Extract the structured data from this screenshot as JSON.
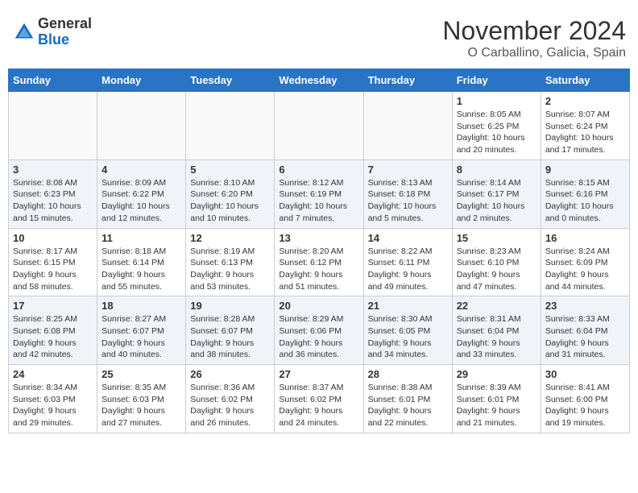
{
  "header": {
    "logo_general": "General",
    "logo_blue": "Blue",
    "month_title": "November 2024",
    "location": "O Carballino, Galicia, Spain"
  },
  "weekdays": [
    "Sunday",
    "Monday",
    "Tuesday",
    "Wednesday",
    "Thursday",
    "Friday",
    "Saturday"
  ],
  "weeks": [
    [
      {
        "day": "",
        "info": ""
      },
      {
        "day": "",
        "info": ""
      },
      {
        "day": "",
        "info": ""
      },
      {
        "day": "",
        "info": ""
      },
      {
        "day": "",
        "info": ""
      },
      {
        "day": "1",
        "info": "Sunrise: 8:05 AM\nSunset: 6:25 PM\nDaylight: 10 hours and 20 minutes."
      },
      {
        "day": "2",
        "info": "Sunrise: 8:07 AM\nSunset: 6:24 PM\nDaylight: 10 hours and 17 minutes."
      }
    ],
    [
      {
        "day": "3",
        "info": "Sunrise: 8:08 AM\nSunset: 6:23 PM\nDaylight: 10 hours and 15 minutes."
      },
      {
        "day": "4",
        "info": "Sunrise: 8:09 AM\nSunset: 6:22 PM\nDaylight: 10 hours and 12 minutes."
      },
      {
        "day": "5",
        "info": "Sunrise: 8:10 AM\nSunset: 6:20 PM\nDaylight: 10 hours and 10 minutes."
      },
      {
        "day": "6",
        "info": "Sunrise: 8:12 AM\nSunset: 6:19 PM\nDaylight: 10 hours and 7 minutes."
      },
      {
        "day": "7",
        "info": "Sunrise: 8:13 AM\nSunset: 6:18 PM\nDaylight: 10 hours and 5 minutes."
      },
      {
        "day": "8",
        "info": "Sunrise: 8:14 AM\nSunset: 6:17 PM\nDaylight: 10 hours and 2 minutes."
      },
      {
        "day": "9",
        "info": "Sunrise: 8:15 AM\nSunset: 6:16 PM\nDaylight: 10 hours and 0 minutes."
      }
    ],
    [
      {
        "day": "10",
        "info": "Sunrise: 8:17 AM\nSunset: 6:15 PM\nDaylight: 9 hours and 58 minutes."
      },
      {
        "day": "11",
        "info": "Sunrise: 8:18 AM\nSunset: 6:14 PM\nDaylight: 9 hours and 55 minutes."
      },
      {
        "day": "12",
        "info": "Sunrise: 8:19 AM\nSunset: 6:13 PM\nDaylight: 9 hours and 53 minutes."
      },
      {
        "day": "13",
        "info": "Sunrise: 8:20 AM\nSunset: 6:12 PM\nDaylight: 9 hours and 51 minutes."
      },
      {
        "day": "14",
        "info": "Sunrise: 8:22 AM\nSunset: 6:11 PM\nDaylight: 9 hours and 49 minutes."
      },
      {
        "day": "15",
        "info": "Sunrise: 8:23 AM\nSunset: 6:10 PM\nDaylight: 9 hours and 47 minutes."
      },
      {
        "day": "16",
        "info": "Sunrise: 8:24 AM\nSunset: 6:09 PM\nDaylight: 9 hours and 44 minutes."
      }
    ],
    [
      {
        "day": "17",
        "info": "Sunrise: 8:25 AM\nSunset: 6:08 PM\nDaylight: 9 hours and 42 minutes."
      },
      {
        "day": "18",
        "info": "Sunrise: 8:27 AM\nSunset: 6:07 PM\nDaylight: 9 hours and 40 minutes."
      },
      {
        "day": "19",
        "info": "Sunrise: 8:28 AM\nSunset: 6:07 PM\nDaylight: 9 hours and 38 minutes."
      },
      {
        "day": "20",
        "info": "Sunrise: 8:29 AM\nSunset: 6:06 PM\nDaylight: 9 hours and 36 minutes."
      },
      {
        "day": "21",
        "info": "Sunrise: 8:30 AM\nSunset: 6:05 PM\nDaylight: 9 hours and 34 minutes."
      },
      {
        "day": "22",
        "info": "Sunrise: 8:31 AM\nSunset: 6:04 PM\nDaylight: 9 hours and 33 minutes."
      },
      {
        "day": "23",
        "info": "Sunrise: 8:33 AM\nSunset: 6:04 PM\nDaylight: 9 hours and 31 minutes."
      }
    ],
    [
      {
        "day": "24",
        "info": "Sunrise: 8:34 AM\nSunset: 6:03 PM\nDaylight: 9 hours and 29 minutes."
      },
      {
        "day": "25",
        "info": "Sunrise: 8:35 AM\nSunset: 6:03 PM\nDaylight: 9 hours and 27 minutes."
      },
      {
        "day": "26",
        "info": "Sunrise: 8:36 AM\nSunset: 6:02 PM\nDaylight: 9 hours and 26 minutes."
      },
      {
        "day": "27",
        "info": "Sunrise: 8:37 AM\nSunset: 6:02 PM\nDaylight: 9 hours and 24 minutes."
      },
      {
        "day": "28",
        "info": "Sunrise: 8:38 AM\nSunset: 6:01 PM\nDaylight: 9 hours and 22 minutes."
      },
      {
        "day": "29",
        "info": "Sunrise: 8:39 AM\nSunset: 6:01 PM\nDaylight: 9 hours and 21 minutes."
      },
      {
        "day": "30",
        "info": "Sunrise: 8:41 AM\nSunset: 6:00 PM\nDaylight: 9 hours and 19 minutes."
      }
    ]
  ]
}
